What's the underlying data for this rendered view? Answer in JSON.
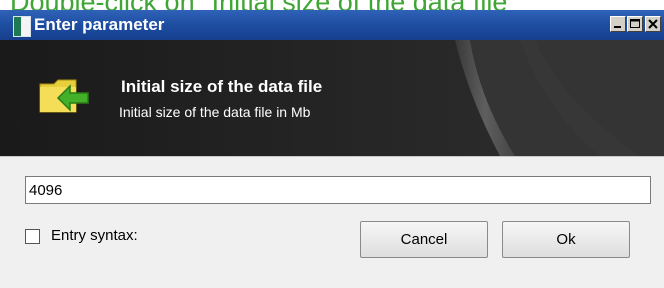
{
  "caption": "Double-click on \"Initial size of the data file\"",
  "window": {
    "title": "Enter parameter"
  },
  "titlebar_buttons": {
    "minimize_icon": "minimize-icon",
    "maximize_icon": "maximize-icon",
    "close_icon": "close-icon"
  },
  "header": {
    "icon": "folder-arrow-icon",
    "title": "Initial size of the data file",
    "subtitle": "Initial size of the data file in Mb"
  },
  "input": {
    "value": "4096"
  },
  "checkbox": {
    "label": "Entry syntax:",
    "checked": false
  },
  "buttons": {
    "cancel": "Cancel",
    "ok": "Ok"
  },
  "colors": {
    "titlebar": "#1f4fa3",
    "header_bg": "#262626",
    "caption_green": "#3ea634"
  }
}
